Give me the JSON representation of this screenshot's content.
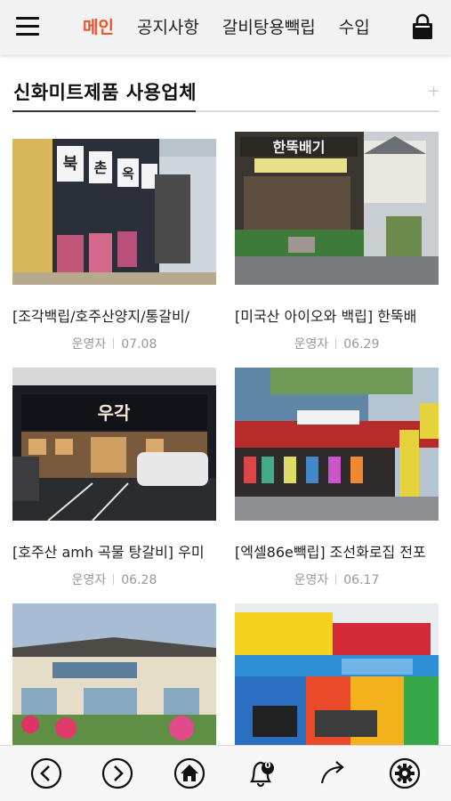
{
  "nav": {
    "tabs": [
      {
        "label": "메인",
        "active": true
      },
      {
        "label": "공지사항",
        "active": false
      },
      {
        "label": "갈비탕용빽립",
        "active": false
      },
      {
        "label": "수입",
        "active": false
      }
    ],
    "menu_icon": "hamburger-menu-icon",
    "cart_icon": "shopping-bag-icon",
    "accent_color": "#f0502a"
  },
  "section": {
    "title": "신화미트제품 사용업체",
    "more_icon": "plus-icon"
  },
  "posts": [
    {
      "title": "[조각백립/호주산양지/통갈비/",
      "author": "운영자",
      "date": "07.08",
      "image": "storefront-bukchonok"
    },
    {
      "title": "[미국산 아이오와 백립] 한뚝배",
      "author": "운영자",
      "date": "06.29",
      "image": "storefront-handdukbaegi"
    },
    {
      "title": "[호주산 amh 곡물 탕갈비] 우미",
      "author": "운영자",
      "date": "06.28",
      "image": "storefront-night-ugak"
    },
    {
      "title": "[엑셀86e빽립] 조선화로집 전포",
      "author": "운영자",
      "date": "06.17",
      "image": "storefront-street-market"
    },
    {
      "title": "",
      "author": "",
      "date": "",
      "image": "storefront-songsaek-sanhwa"
    },
    {
      "title": "",
      "author": "",
      "date": "",
      "image": "storefront-pizza-pasta"
    }
  ],
  "bottom_bar": {
    "buttons": [
      {
        "name": "back-button",
        "icon": "chevron-left-icon"
      },
      {
        "name": "forward-button",
        "icon": "chevron-right-icon"
      },
      {
        "name": "home-button",
        "icon": "home-icon"
      },
      {
        "name": "notifications-button",
        "icon": "bell-icon",
        "badge": "0"
      },
      {
        "name": "share-button",
        "icon": "share-arrow-icon"
      },
      {
        "name": "settings-button",
        "icon": "gear-icon"
      }
    ]
  }
}
